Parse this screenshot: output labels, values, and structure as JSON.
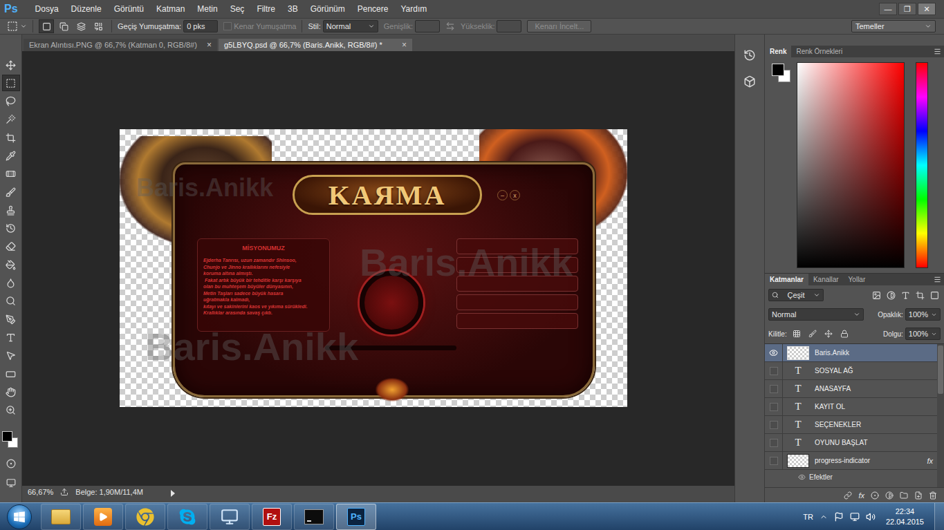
{
  "app": {
    "logo": "Ps"
  },
  "menu": [
    "Dosya",
    "Düzenle",
    "Görüntü",
    "Katman",
    "Metin",
    "Seç",
    "Filtre",
    "3B",
    "Görünüm",
    "Pencere",
    "Yardım"
  ],
  "window_controls": [
    "—",
    "❐",
    "✕"
  ],
  "options_bar": {
    "selection_modes": [
      {
        "selected": true
      },
      {
        "selected": false
      },
      {
        "selected": false
      },
      {
        "selected": false
      }
    ],
    "feather_label": "Geçiş Yumuşatma:",
    "feather_value": "0 pks",
    "antialias": {
      "label": "Kenar Yumuşatma",
      "checked": false,
      "disabled": true
    },
    "style_label": "Stil:",
    "style_value": "Normal",
    "width": {
      "label": "Genişlik:",
      "disabled": true
    },
    "height": {
      "label": "Yükseklik:",
      "disabled": true
    },
    "refine_button": "Kenarı İncelt...",
    "workspace": "Temeller"
  },
  "document_tabs": [
    {
      "label": "Ekran Alıntısı.PNG @ 66,7% (Katman 0, RGB/8#)",
      "selected": false,
      "close": "×"
    },
    {
      "label": "g5LBYQ.psd @ 66,7% (Baris.Anikk, RGB/8#) *",
      "selected": true,
      "close": "×"
    }
  ],
  "tools": [
    {
      "selected": false
    },
    {
      "selected": true
    },
    {
      "selected": false
    },
    {
      "selected": false
    },
    {
      "selected": false
    },
    {
      "selected": false
    },
    {
      "selected": false
    },
    {
      "selected": false
    },
    {
      "selected": false
    },
    {
      "selected": false
    },
    {
      "selected": false
    },
    {
      "selected": false
    },
    {
      "selected": false
    },
    {
      "selected": false
    },
    {
      "selected": false
    },
    {
      "selected": false
    },
    {
      "selected": false
    },
    {
      "selected": false
    },
    {
      "selected": false
    },
    {
      "selected": false
    }
  ],
  "canvas": {
    "logo": "KAЯMA",
    "window_buttons": [
      "–",
      "x"
    ],
    "mission_title": "MİSYONUMUZ",
    "mission_lines": [
      "Ejderha Tanrısı, uzun zamandır Shinsoo,",
      "Chunjo ve Jinno krallıklarını nefesiyle",
      "koruma altına almıştı.",
      " Fakat artık büyük bir tehditle karşı karşıya",
      "olan bu muhteşem büyüler dünyasının,",
      "Metin Taşları sadece büyük hasara",
      "uğratmakla kalmadı,",
      "kıtayı ve sakinlerini kaos ve yıkıma sürükledi.",
      "Krallıklar arasında savaş çıktı."
    ],
    "watermark": "Baris.Anikk"
  },
  "status_bar": {
    "zoom": "66,67%",
    "doc_size": "Belge: 1,90M/11,4M"
  },
  "color_panel": {
    "tabs": [
      {
        "label": "Renk",
        "selected": true
      },
      {
        "label": "Renk Örnekleri",
        "selected": false
      }
    ]
  },
  "layers_panel": {
    "tabs": [
      {
        "label": "Katmanlar",
        "selected": true
      },
      {
        "label": "Kanallar",
        "selected": false
      },
      {
        "label": "Yollar",
        "selected": false
      }
    ],
    "filter": "Çeşit",
    "blend_mode": "Normal",
    "opacity_label": "Opaklık:",
    "opacity": "100%",
    "lock_label": "Kilitle:",
    "fill_label": "Dolgu:",
    "fill": "100%",
    "layers": [
      {
        "name": "Baris.Anikk",
        "kind": "raster",
        "visible": true,
        "selected": true
      },
      {
        "name": "SOSYAL AĞ",
        "kind": "text",
        "thumb": "T",
        "visible": false,
        "selected": false
      },
      {
        "name": "ANASAYFA",
        "kind": "text",
        "thumb": "T",
        "visible": false,
        "selected": false
      },
      {
        "name": "KAYIT OL",
        "kind": "text",
        "thumb": "T",
        "visible": false,
        "selected": false
      },
      {
        "name": "SEÇENEKLER",
        "kind": "text",
        "thumb": "T",
        "visible": false,
        "selected": false
      },
      {
        "name": "OYUNU BAŞLAT",
        "kind": "text",
        "thumb": "T",
        "visible": false,
        "selected": false
      },
      {
        "name": "progress-indicator",
        "kind": "raster",
        "visible": false,
        "selected": false,
        "effects": {
          "badge": "fx",
          "label": "Efektler"
        }
      }
    ],
    "footer_fx": "fx"
  },
  "taskbar": {
    "apps": [
      {
        "kind": "explorer",
        "selected": false
      },
      {
        "kind": "media",
        "selected": false
      },
      {
        "kind": "chrome",
        "selected": false
      },
      {
        "kind": "skype",
        "selected": false
      },
      {
        "kind": "network",
        "selected": false
      },
      {
        "kind": "filezilla",
        "glyph": "Fz",
        "selected": false
      },
      {
        "kind": "cmd",
        "selected": false
      },
      {
        "kind": "photoshop",
        "selected": true
      }
    ],
    "lang": "TR",
    "time": "22:34",
    "date": "22.04.2015"
  }
}
